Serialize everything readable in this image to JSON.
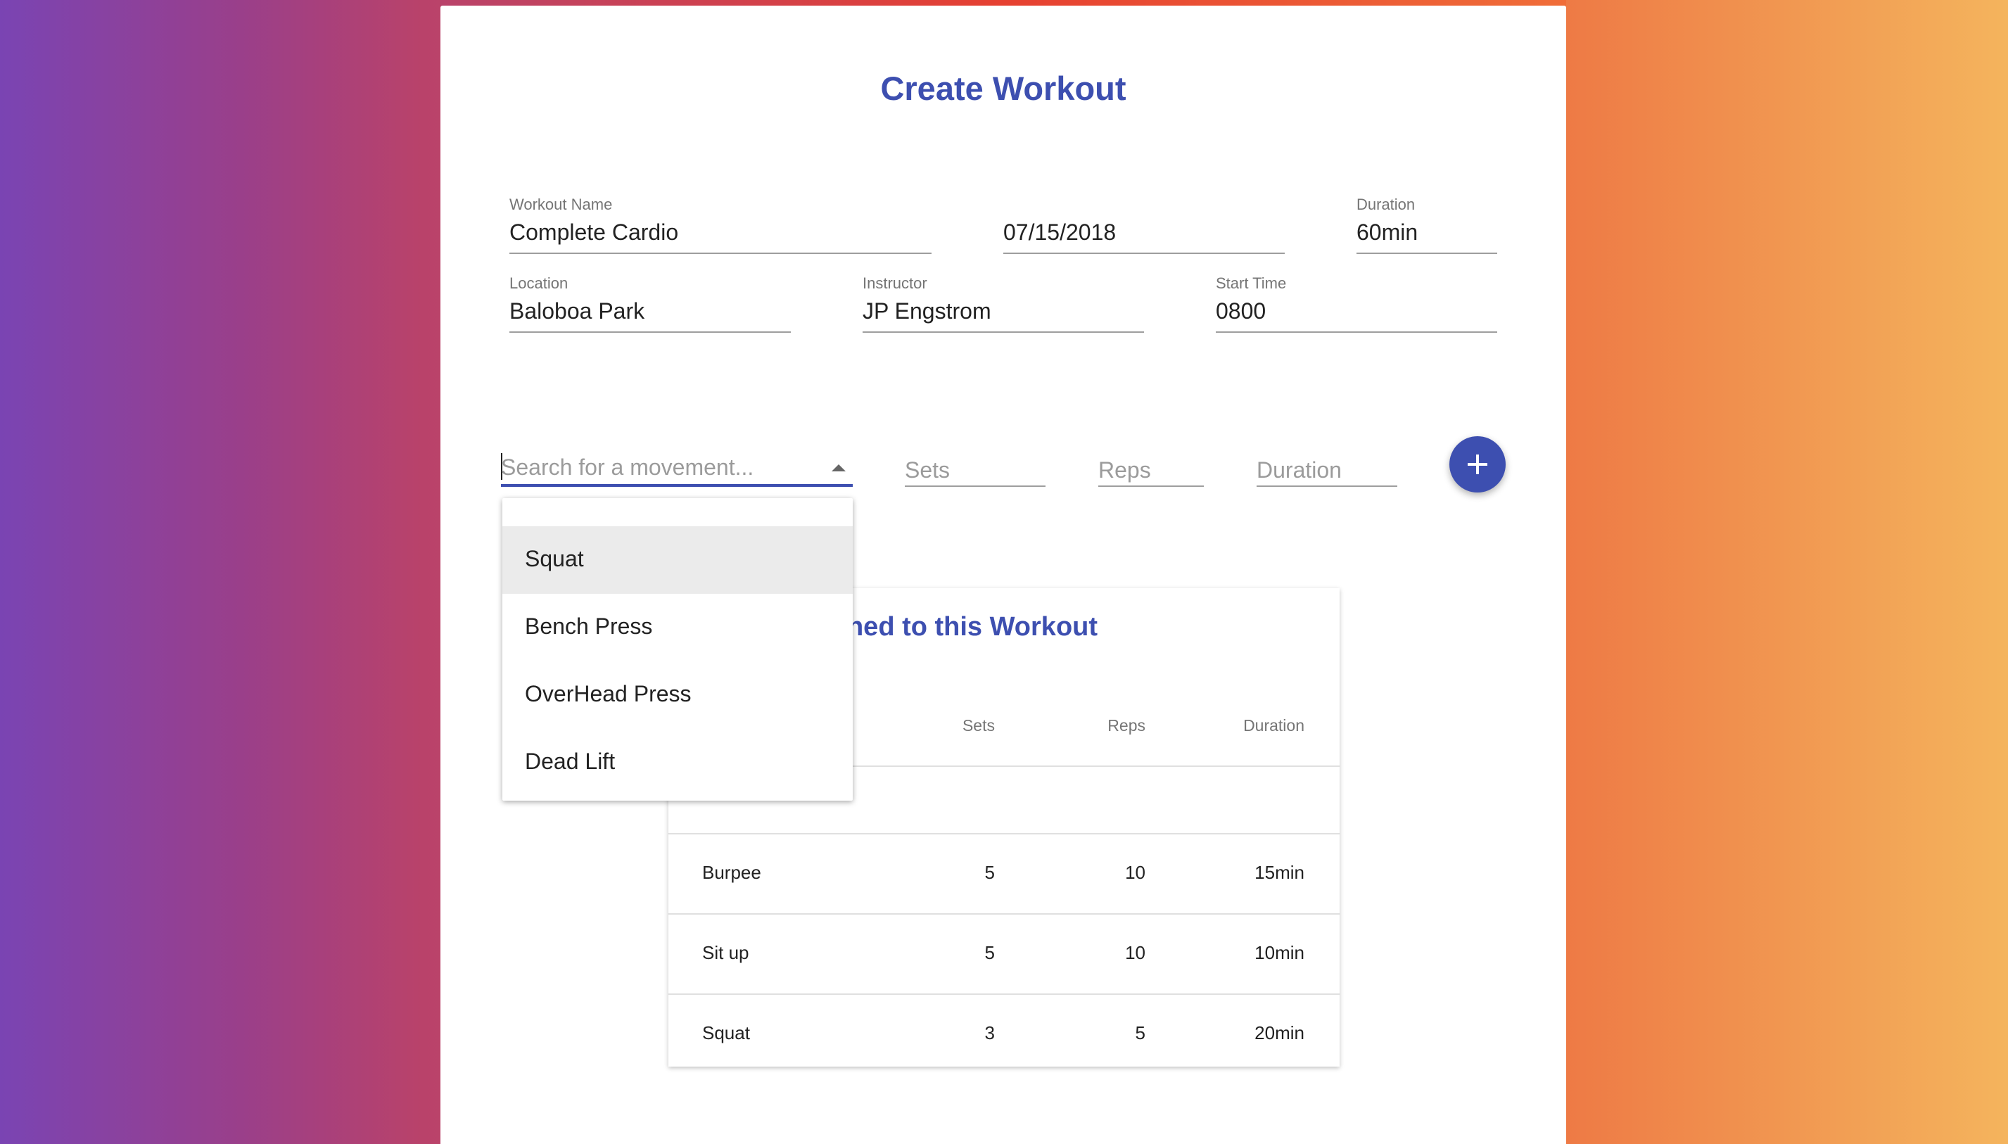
{
  "page": {
    "title": "Create Workout"
  },
  "form": {
    "workout_name": {
      "label": "Workout Name",
      "value": "Complete Cardio"
    },
    "date": {
      "label": "",
      "value": "07/15/2018"
    },
    "duration": {
      "label": "Duration",
      "value": "60min"
    },
    "location": {
      "label": "Location",
      "value": "Baloboa Park"
    },
    "instructor": {
      "label": "Instructor",
      "value": "JP Engstrom"
    },
    "start_time": {
      "label": "Start Time",
      "value": "0800"
    }
  },
  "movement_entry": {
    "search_placeholder": "Search for a movement...",
    "sets_placeholder": "Sets",
    "reps_placeholder": "Reps",
    "duration_placeholder": "Duration",
    "add_icon": "plus-icon"
  },
  "dropdown": {
    "options": [
      "Squat",
      "Bench Press",
      "OverHead Press",
      "Dead Lift"
    ],
    "highlighted": "Squat"
  },
  "movements_table": {
    "title": "Movements Assigned to this Workout",
    "visible_title": "nents Assigned to this Workout",
    "columns": [
      "Sets",
      "Reps",
      "Duration"
    ],
    "rows": [
      {
        "movement": "Burpee",
        "sets": "5",
        "reps": "10",
        "duration": "15min"
      },
      {
        "movement": "Sit up",
        "sets": "5",
        "reps": "10",
        "duration": "10min"
      },
      {
        "movement": "Squat",
        "sets": "3",
        "reps": "5",
        "duration": "20min"
      }
    ]
  },
  "colors": {
    "accent": "#3d4fb0",
    "highlight": "#ebebeb"
  }
}
